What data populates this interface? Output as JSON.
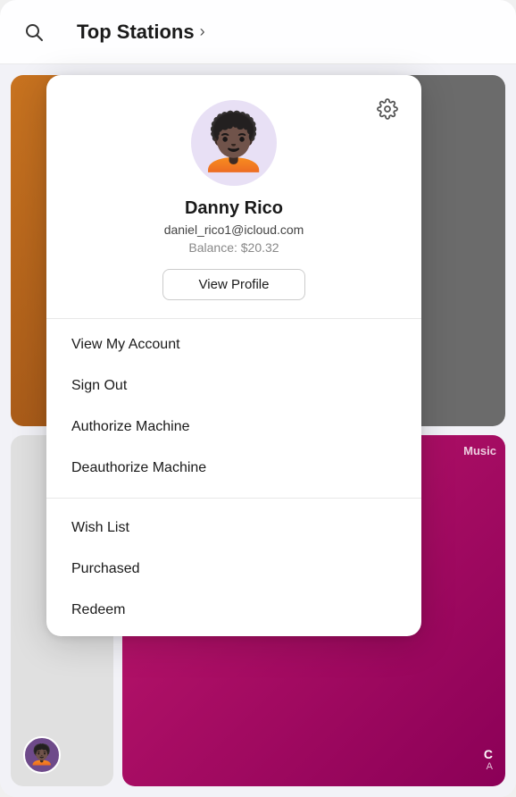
{
  "app": {
    "title": "Top Stations",
    "chevron": "›"
  },
  "topbar": {
    "search_icon": "⌕"
  },
  "user": {
    "name": "Danny Rico",
    "email": "daniel_rico1@icloud.com",
    "balance": "Balance: $20.32",
    "avatar_emoji": "🧑🏿‍🦱",
    "view_profile_label": "View Profile"
  },
  "menu": {
    "section1": [
      {
        "label": "View My Account"
      },
      {
        "label": "Sign Out"
      },
      {
        "label": "Authorize Machine"
      },
      {
        "label": "Deauthorize Machine"
      }
    ],
    "section2": [
      {
        "label": "Wish List"
      },
      {
        "label": "Purchased"
      },
      {
        "label": "Redeem"
      }
    ]
  },
  "cards": {
    "top_right_label": "Music",
    "bottom_right_label": "Music",
    "card_c_title": "C",
    "card_c_sub": "A"
  },
  "gear_icon": "⚙",
  "small_avatar_emoji": "🧑🏿‍🦱"
}
